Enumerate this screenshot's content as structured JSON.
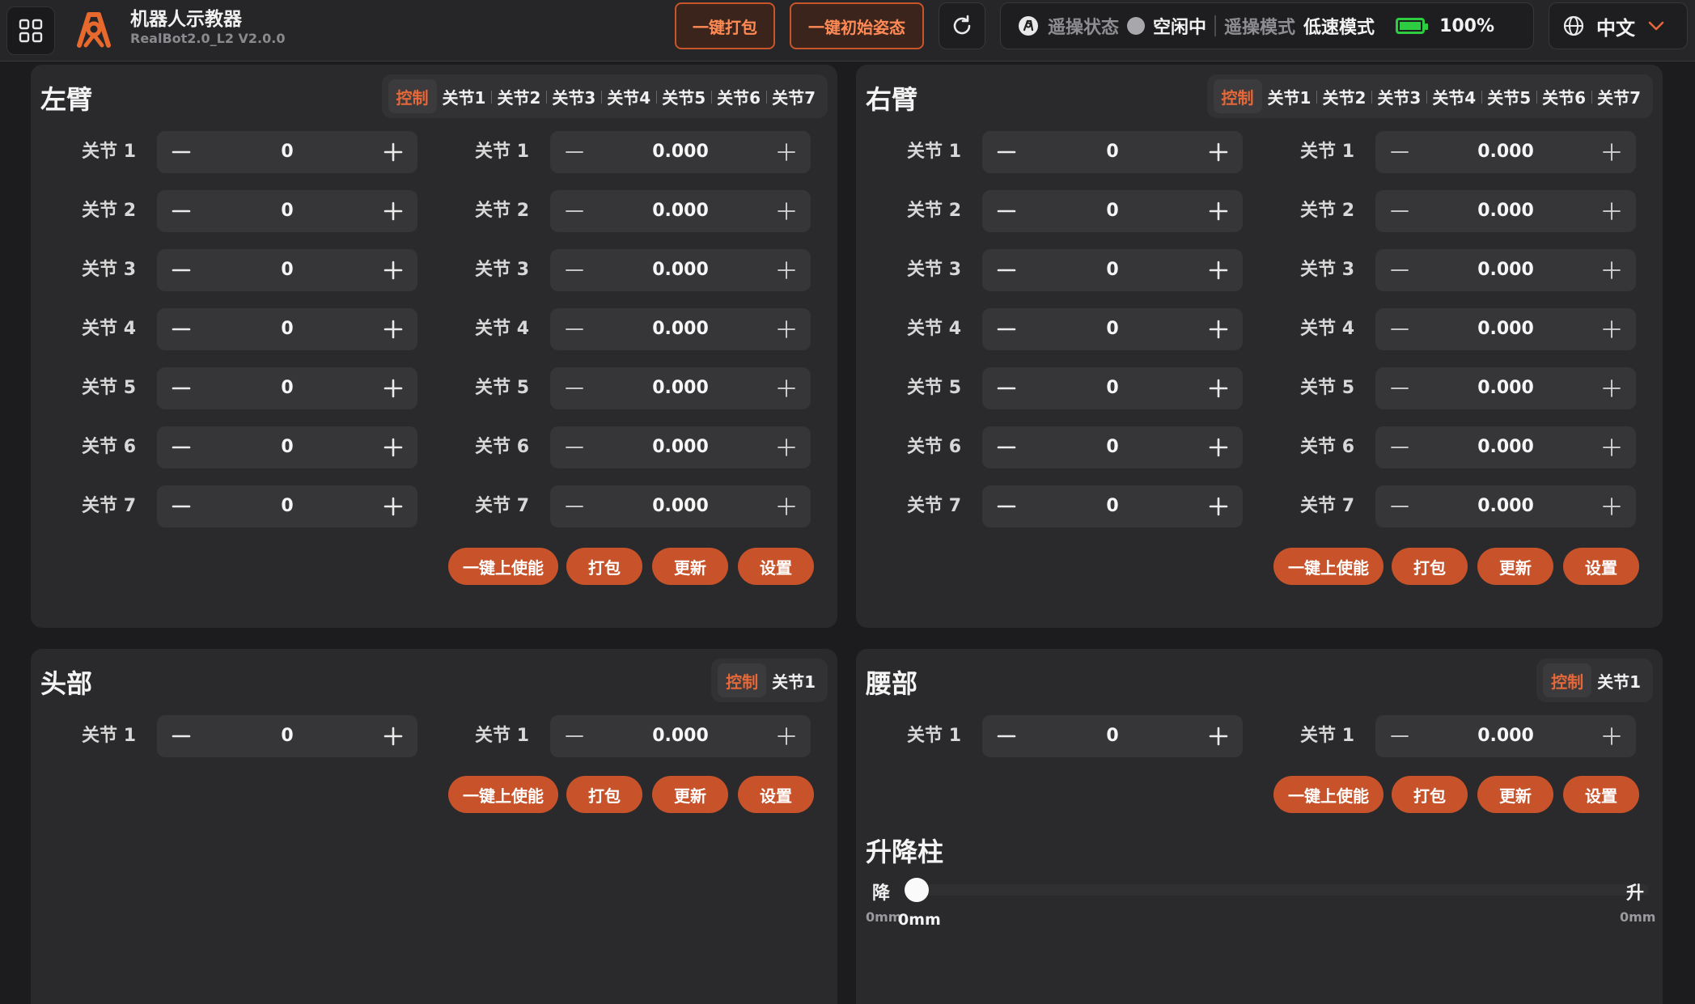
{
  "header": {
    "app_title": "机器人示教器",
    "version": "RealBot2.0_L2 V2.0.0",
    "pack_all_label": "一键打包",
    "init_pose_label": "一键初始姿态",
    "teleop_status_label": "遥操状态",
    "teleop_status_value": "空闲中",
    "teleop_mode_label": "遥操模式",
    "teleop_mode_value": "低速模式",
    "battery": "100%",
    "language": "中文"
  },
  "colors": {
    "accent": "#c8532a",
    "tab_active": "#e4683a",
    "battery": "#2ecc40"
  },
  "left_arm": {
    "title": "左臂",
    "tabs": [
      "控制",
      "关节1",
      "关节2",
      "关节3",
      "关节4",
      "关节5",
      "关节6",
      "关节7"
    ],
    "joints": [
      {
        "label": "关节 1",
        "step": "0",
        "pos": "0.000"
      },
      {
        "label": "关节 2",
        "step": "0",
        "pos": "0.000"
      },
      {
        "label": "关节 3",
        "step": "0",
        "pos": "0.000"
      },
      {
        "label": "关节 4",
        "step": "0",
        "pos": "0.000"
      },
      {
        "label": "关节 5",
        "step": "0",
        "pos": "0.000"
      },
      {
        "label": "关节 6",
        "step": "0",
        "pos": "0.000"
      },
      {
        "label": "关节 7",
        "step": "0",
        "pos": "0.000"
      }
    ],
    "actions": {
      "enable": "一键上使能",
      "pack": "打包",
      "update": "更新",
      "settings": "设置"
    }
  },
  "right_arm": {
    "title": "右臂",
    "tabs": [
      "控制",
      "关节1",
      "关节2",
      "关节3",
      "关节4",
      "关节5",
      "关节6",
      "关节7"
    ],
    "joints": [
      {
        "label": "关节 1",
        "step": "0",
        "pos": "0.000"
      },
      {
        "label": "关节 2",
        "step": "0",
        "pos": "0.000"
      },
      {
        "label": "关节 3",
        "step": "0",
        "pos": "0.000"
      },
      {
        "label": "关节 4",
        "step": "0",
        "pos": "0.000"
      },
      {
        "label": "关节 5",
        "step": "0",
        "pos": "0.000"
      },
      {
        "label": "关节 6",
        "step": "0",
        "pos": "0.000"
      },
      {
        "label": "关节 7",
        "step": "0",
        "pos": "0.000"
      }
    ],
    "actions": {
      "enable": "一键上使能",
      "pack": "打包",
      "update": "更新",
      "settings": "设置"
    }
  },
  "head": {
    "title": "头部",
    "tabs": [
      "控制",
      "关节1"
    ],
    "joints": [
      {
        "label": "关节 1",
        "step": "0",
        "pos": "0.000"
      }
    ],
    "actions": {
      "enable": "一键上使能",
      "pack": "打包",
      "update": "更新",
      "settings": "设置"
    }
  },
  "waist": {
    "title": "腰部",
    "tabs": [
      "控制",
      "关节1"
    ],
    "joints": [
      {
        "label": "关节 1",
        "step": "0",
        "pos": "0.000"
      }
    ],
    "actions": {
      "enable": "一键上使能",
      "pack": "打包",
      "update": "更新",
      "settings": "设置"
    }
  },
  "lift": {
    "title": "升降柱",
    "down_label": "降",
    "up_label": "升",
    "min": "0mm",
    "max": "0mm",
    "current": "0mm",
    "level": 0
  }
}
